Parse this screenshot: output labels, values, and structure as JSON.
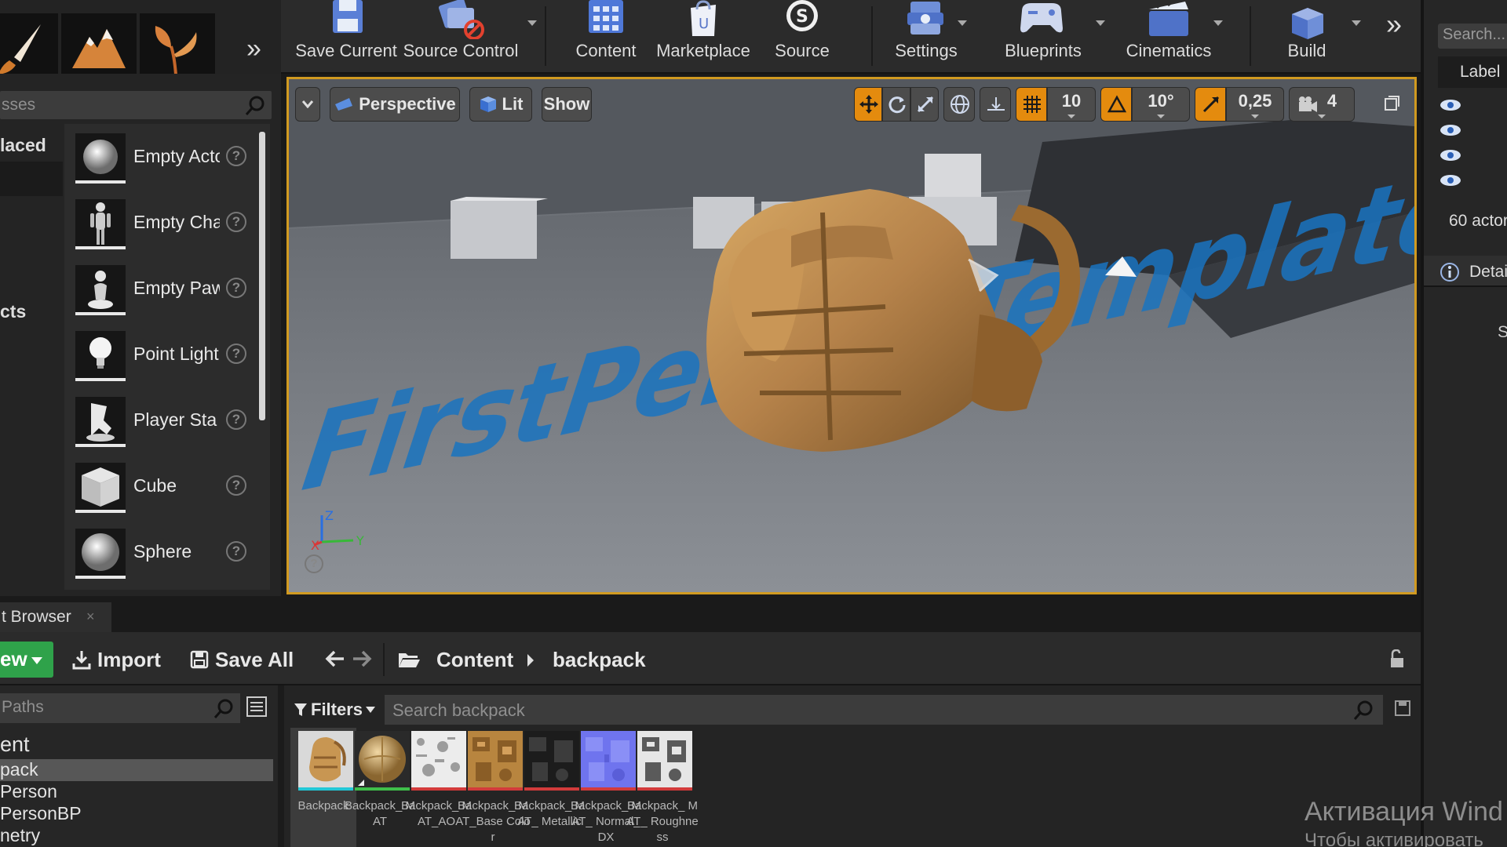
{
  "modes": {
    "more_label": "»"
  },
  "toolbar": {
    "buttons": [
      {
        "label": "Save Current",
        "icon": "save-icon"
      },
      {
        "label": "Source Control",
        "icon": "source-control-icon"
      },
      {
        "label": "Content",
        "icon": "content-icon"
      },
      {
        "label": "Marketplace",
        "icon": "marketplace-icon"
      },
      {
        "label": "Source",
        "icon": "source-icon"
      },
      {
        "label": "Settings",
        "icon": "settings-icon"
      },
      {
        "label": "Blueprints",
        "icon": "blueprints-icon"
      },
      {
        "label": "Cinematics",
        "icon": "cinematics-icon"
      },
      {
        "label": "Build",
        "icon": "build-icon"
      }
    ],
    "more_label": "»"
  },
  "place": {
    "search_placeholder": "sses",
    "category_recent": "laced",
    "category_visual": "cts",
    "items": [
      {
        "name": "Empty Acto",
        "icon": "empty-actor-icon"
      },
      {
        "name": "Empty Cha",
        "icon": "empty-character-icon"
      },
      {
        "name": "Empty Paw",
        "icon": "empty-pawn-icon"
      },
      {
        "name": "Point Light",
        "icon": "point-light-icon"
      },
      {
        "name": "Player Sta",
        "icon": "player-start-icon"
      },
      {
        "name": "Cube",
        "icon": "cube-icon"
      },
      {
        "name": "Sphere",
        "icon": "sphere-icon"
      }
    ],
    "help_glyph": "?"
  },
  "viewport": {
    "perspective_label": "Perspective",
    "lit_label": "Lit",
    "show_label": "Show",
    "grid_snap": "10",
    "rotation_snap": "10°",
    "scale_snap": "0,25",
    "camera_speed": "4",
    "floor_text": "FirstPersonTemplate",
    "axis_z": "Z",
    "axis_x": "X",
    "axis_y": "Y",
    "help_glyph": "?"
  },
  "outliner": {
    "search_placeholder": "Search...",
    "column_label": "Label",
    "actor_count": "60 actor",
    "details_tab": "Detai",
    "details_s": "S"
  },
  "content_browser": {
    "tab_label": "t Browser",
    "tab_close": "×",
    "new_label": "ew",
    "import_label": "Import",
    "save_all_label": "Save All",
    "breadcrumb_root": "Content",
    "breadcrumb_current": "backpack",
    "paths_placeholder": "Paths",
    "tree": [
      {
        "label": "ent",
        "selected": false,
        "root": true
      },
      {
        "label": "pack",
        "selected": true,
        "root": false
      },
      {
        "label": "Person",
        "selected": false,
        "root": false
      },
      {
        "label": "PersonBP",
        "selected": false,
        "root": false
      },
      {
        "label": "netry",
        "selected": false,
        "root": false
      }
    ],
    "filters_label": "Filters",
    "search_placeholder": "Search backpack",
    "assets": [
      {
        "name": "Backpack",
        "bar": "#22c7d6",
        "kind": "mesh"
      },
      {
        "name": "Backpack_ MAT",
        "bar": "#3fbf4a",
        "kind": "material"
      },
      {
        "name": "Backpack_ MAT_AO",
        "bar": "#d23b3b",
        "kind": "ao"
      },
      {
        "name": "Backpack_ MAT_Base Color",
        "bar": "#d23b3b",
        "kind": "basecolor"
      },
      {
        "name": "Backpack_ MAT_ Metallic",
        "bar": "#d23b3b",
        "kind": "metallic"
      },
      {
        "name": "Backpack_ MAT_ Normal_DX",
        "bar": "#d23b3b",
        "kind": "normal"
      },
      {
        "name": "Backpack_ MAT_ Roughness",
        "bar": "#d23b3b",
        "kind": "roughness"
      }
    ]
  },
  "system": {
    "activation_line1": "Активация Wind",
    "activation_line2": "Чтобы активировать"
  },
  "colors": {
    "viewport_border": "#d19a20",
    "active_tool": "#e48b0e",
    "new_button": "#2fa24a"
  }
}
